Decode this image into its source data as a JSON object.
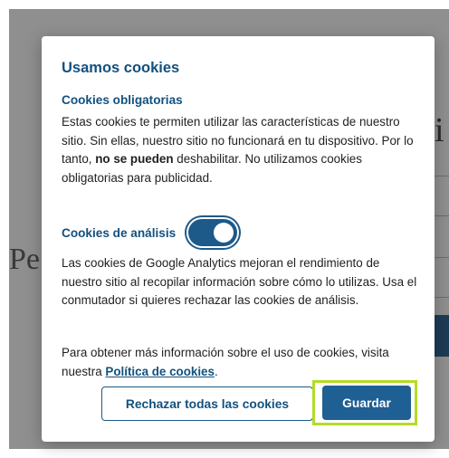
{
  "background": {
    "partial_heading": "Pe",
    "partial_letter": "i"
  },
  "dialog": {
    "title": "Usamos cookies",
    "mandatory": {
      "heading": "Cookies obligatorias",
      "text_before_bold": "Estas cookies te permiten utilizar las características de nuestro sitio. Sin ellas, nuestro sitio no funcionará en tu dispositivo. Por lo tanto, ",
      "bold_text": "no se pueden",
      "text_after_bold": " deshabilitar. No utilizamos cookies obligatorias para publicidad."
    },
    "analytics": {
      "heading": "Cookies de análisis",
      "toggle_on": true,
      "text": "Las cookies de Google Analytics mejoran el rendimiento de nuestro sitio al recopilar información sobre cómo lo utilizas. Usa el conmutador si quieres rechazar las cookies de análisis."
    },
    "more_info": {
      "text_before_link": "Para obtener más información sobre el uso de cookies, visita nuestra ",
      "link_text": "Política de cookies",
      "text_after_link": "."
    },
    "buttons": {
      "reject_all": "Rechazar todas las cookies",
      "save": "Guardar"
    }
  },
  "colors": {
    "accent": "#12517e",
    "toggle": "#1d5a89",
    "save_button": "#1e5f94",
    "highlight": "#b3dc25",
    "overlay": "#8f8f8f"
  }
}
